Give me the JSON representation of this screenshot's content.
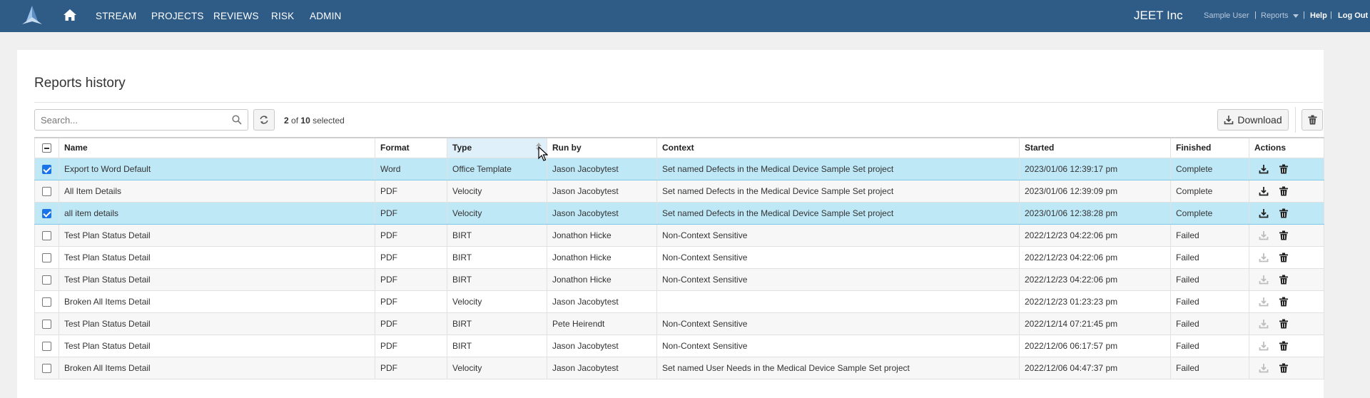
{
  "nav": {
    "items": [
      "STREAM",
      "PROJECTS",
      "REVIEWS",
      "RISK",
      "ADMIN"
    ],
    "company": "JEET Inc",
    "user": "Sample User",
    "reports": "Reports",
    "help": "Help",
    "logout": "Log Out",
    "separator": "|"
  },
  "page": {
    "title": "Reports history",
    "search_placeholder": "Search...",
    "selected_count": "2",
    "selected_of": "of",
    "selected_total": "10",
    "selected_suffix": "selected",
    "download_label": "Download"
  },
  "table": {
    "headers": [
      "Name",
      "Format",
      "Type",
      "Run by",
      "Context",
      "Started",
      "Finished",
      "Actions"
    ],
    "rows": [
      {
        "checked": true,
        "name": "Export to Word Default",
        "format": "Word",
        "type": "Office Template",
        "run_by": "Jason Jacobytest",
        "context": "Set named Defects in the Medical Device Sample Set project",
        "started": "2023/01/06 12:39:17 pm",
        "finished": "Complete",
        "download_enabled": true
      },
      {
        "checked": false,
        "name": "All Item Details",
        "format": "PDF",
        "type": "Velocity",
        "run_by": "Jason Jacobytest",
        "context": "Set named Defects in the Medical Device Sample Set project",
        "started": "2023/01/06 12:39:09 pm",
        "finished": "Complete",
        "download_enabled": true
      },
      {
        "checked": true,
        "name": "all item details",
        "format": "PDF",
        "type": "Velocity",
        "run_by": "Jason Jacobytest",
        "context": "Set named Defects in the Medical Device Sample Set project",
        "started": "2023/01/06 12:38:28 pm",
        "finished": "Complete",
        "download_enabled": true
      },
      {
        "checked": false,
        "name": "Test Plan Status Detail",
        "format": "PDF",
        "type": "BIRT",
        "run_by": "Jonathon Hicke",
        "context": "Non-Context Sensitive",
        "started": "2022/12/23 04:22:06 pm",
        "finished": "Failed",
        "download_enabled": false
      },
      {
        "checked": false,
        "name": "Test Plan Status Detail",
        "format": "PDF",
        "type": "BIRT",
        "run_by": "Jonathon Hicke",
        "context": "Non-Context Sensitive",
        "started": "2022/12/23 04:22:06 pm",
        "finished": "Failed",
        "download_enabled": false
      },
      {
        "checked": false,
        "name": "Test Plan Status Detail",
        "format": "PDF",
        "type": "BIRT",
        "run_by": "Jonathon Hicke",
        "context": "Non-Context Sensitive",
        "started": "2022/12/23 04:22:06 pm",
        "finished": "Failed",
        "download_enabled": false
      },
      {
        "checked": false,
        "name": "Broken All Items Detail",
        "format": "PDF",
        "type": "Velocity",
        "run_by": "Jason Jacobytest",
        "context": "",
        "started": "2022/12/23 01:23:23 pm",
        "finished": "Failed",
        "download_enabled": false
      },
      {
        "checked": false,
        "name": "Test Plan Status Detail",
        "format": "PDF",
        "type": "BIRT",
        "run_by": "Pete Heirendt",
        "context": "Non-Context Sensitive",
        "started": "2022/12/14 07:21:45 pm",
        "finished": "Failed",
        "download_enabled": false
      },
      {
        "checked": false,
        "name": "Test Plan Status Detail",
        "format": "PDF",
        "type": "BIRT",
        "run_by": "Jason Jacobytest",
        "context": "Non-Context Sensitive",
        "started": "2022/12/06 06:17:57 pm",
        "finished": "Failed",
        "download_enabled": false
      },
      {
        "checked": false,
        "name": "Broken All Items Detail",
        "format": "PDF",
        "type": "Velocity",
        "run_by": "Jason Jacobytest",
        "context": "Set named User Needs in the Medical Device Sample Set project",
        "started": "2022/12/06 04:47:37 pm",
        "finished": "Failed",
        "download_enabled": false
      }
    ]
  },
  "colors": {
    "nav_bg": "#2f5b87",
    "selected_row": "#bfe8f7",
    "checkbox": "#1a73e8"
  }
}
